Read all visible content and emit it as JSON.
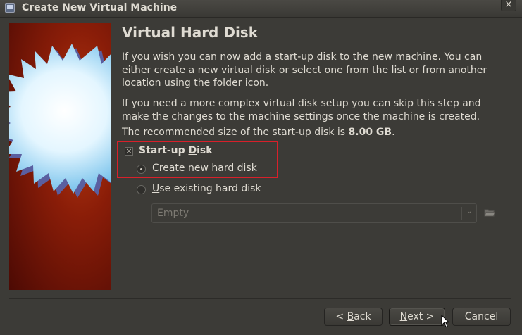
{
  "window": {
    "title": "Create New Virtual Machine",
    "close_glyph": "×"
  },
  "page": {
    "heading": "Virtual Hard Disk",
    "paragraph1": "If you wish you can now add a start-up disk to the new machine. You can either create a new virtual disk or select one from the list or from another location using the folder icon.",
    "paragraph2": "If you need a more complex virtual disk setup you can skip this step and make the changes to the machine settings once the machine is created.",
    "recommended_prefix": "The recommended size of the start-up disk is ",
    "recommended_size": "8.00 GB",
    "recommended_suffix": "."
  },
  "startup_disk": {
    "checked": true,
    "check_glyph": "×",
    "label_pre": "Start-up ",
    "label_mnemonic": "D",
    "label_post": "isk"
  },
  "options": {
    "create_new": {
      "selected": true,
      "mnemonic": "C",
      "rest": "reate new hard disk"
    },
    "use_existing": {
      "selected": false,
      "mnemonic": "U",
      "rest": "se existing hard disk"
    }
  },
  "existing_disk_combo": {
    "value": "Empty",
    "arrow_glyph": "⌄"
  },
  "buttons": {
    "back": {
      "prefix": "< ",
      "mnemonic": "B",
      "rest": "ack"
    },
    "next": {
      "mnemonic": "N",
      "rest": "ext >"
    },
    "cancel": {
      "label": "Cancel"
    }
  },
  "colors": {
    "background": "#3c3b37",
    "text": "#dfdbd2",
    "highlight_box": "#d8202a",
    "banner_red": "#8a1d08",
    "disabled_text": "#7d7a73"
  },
  "icons": {
    "title": "virtualbox-icon",
    "folder": "folder-open-icon",
    "banner": "starburst-icon"
  }
}
